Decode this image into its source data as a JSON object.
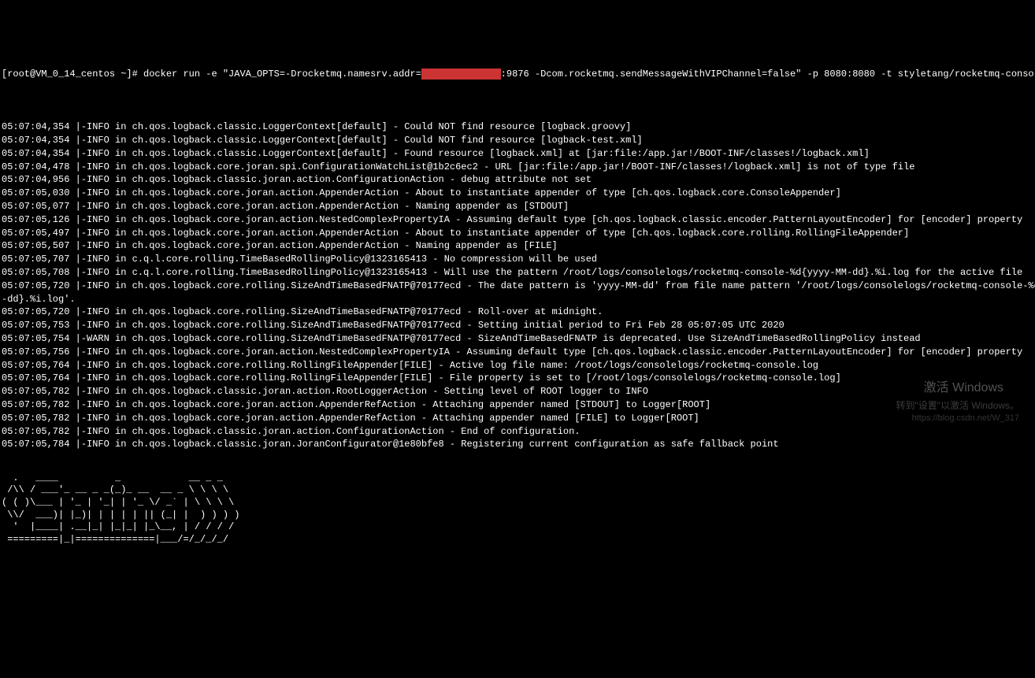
{
  "prompt": {
    "user_host": "[root@VM_0_14_centos ~]# ",
    "command_pre": "docker run -e \"JAVA_OPTS=-Drocketmq.namesrv.addr=",
    "redacted": "xx.xxx.xxx.xxx",
    "command_post": ":9876 -Dcom.rocketmq.sendMessageWithVIPChannel=false\" -p 8080:8080 -t styletang/rocketmq-console-ng"
  },
  "logs": [
    "05:07:04,354 |-INFO in ch.qos.logback.classic.LoggerContext[default] - Could NOT find resource [logback.groovy]",
    "05:07:04,354 |-INFO in ch.qos.logback.classic.LoggerContext[default] - Could NOT find resource [logback-test.xml]",
    "05:07:04,354 |-INFO in ch.qos.logback.classic.LoggerContext[default] - Found resource [logback.xml] at [jar:file:/app.jar!/BOOT-INF/classes!/logback.xml]",
    "05:07:04,478 |-INFO in ch.qos.logback.core.joran.spi.ConfigurationWatchList@1b2c6ec2 - URL [jar:file:/app.jar!/BOOT-INF/classes!/logback.xml] is not of type file",
    "05:07:04,956 |-INFO in ch.qos.logback.classic.joran.action.ConfigurationAction - debug attribute not set",
    "05:07:05,030 |-INFO in ch.qos.logback.core.joran.action.AppenderAction - About to instantiate appender of type [ch.qos.logback.core.ConsoleAppender]",
    "05:07:05,077 |-INFO in ch.qos.logback.core.joran.action.AppenderAction - Naming appender as [STDOUT]",
    "05:07:05,126 |-INFO in ch.qos.logback.core.joran.action.NestedComplexPropertyIA - Assuming default type [ch.qos.logback.classic.encoder.PatternLayoutEncoder] for [encoder] property",
    "05:07:05,497 |-INFO in ch.qos.logback.core.joran.action.AppenderAction - About to instantiate appender of type [ch.qos.logback.core.rolling.RollingFileAppender]",
    "05:07:05,507 |-INFO in ch.qos.logback.core.joran.action.AppenderAction - Naming appender as [FILE]",
    "05:07:05,707 |-INFO in c.q.l.core.rolling.TimeBasedRollingPolicy@1323165413 - No compression will be used",
    "05:07:05,708 |-INFO in c.q.l.core.rolling.TimeBasedRollingPolicy@1323165413 - Will use the pattern /root/logs/consolelogs/rocketmq-console-%d{yyyy-MM-dd}.%i.log for the active file",
    "05:07:05,720 |-INFO in ch.qos.logback.core.rolling.SizeAndTimeBasedFNATP@70177ecd - The date pattern is 'yyyy-MM-dd' from file name pattern '/root/logs/consolelogs/rocketmq-console-%d{yyyy",
    "-dd}.%i.log'.",
    "05:07:05,720 |-INFO in ch.qos.logback.core.rolling.SizeAndTimeBasedFNATP@70177ecd - Roll-over at midnight.",
    "05:07:05,753 |-INFO in ch.qos.logback.core.rolling.SizeAndTimeBasedFNATP@70177ecd - Setting initial period to Fri Feb 28 05:07:05 UTC 2020",
    "05:07:05,754 |-WARN in ch.qos.logback.core.rolling.SizeAndTimeBasedFNATP@70177ecd - SizeAndTimeBasedFNATP is deprecated. Use SizeAndTimeBasedRollingPolicy instead",
    "05:07:05,756 |-INFO in ch.qos.logback.core.joran.action.NestedComplexPropertyIA - Assuming default type [ch.qos.logback.classic.encoder.PatternLayoutEncoder] for [encoder] property",
    "05:07:05,764 |-INFO in ch.qos.logback.core.rolling.RollingFileAppender[FILE] - Active log file name: /root/logs/consolelogs/rocketmq-console.log",
    "05:07:05,764 |-INFO in ch.qos.logback.core.rolling.RollingFileAppender[FILE] - File property is set to [/root/logs/consolelogs/rocketmq-console.log]",
    "05:07:05,782 |-INFO in ch.qos.logback.classic.joran.action.RootLoggerAction - Setting level of ROOT logger to INFO",
    "05:07:05,782 |-INFO in ch.qos.logback.core.joran.action.AppenderRefAction - Attaching appender named [STDOUT] to Logger[ROOT]",
    "05:07:05,782 |-INFO in ch.qos.logback.core.joran.action.AppenderRefAction - Attaching appender named [FILE] to Logger[ROOT]",
    "05:07:05,782 |-INFO in ch.qos.logback.classic.joran.action.ConfigurationAction - End of configuration.",
    "05:07:05,784 |-INFO in ch.qos.logback.classic.joran.JoranConfigurator@1e80bfe8 - Registering current configuration as safe fallback point"
  ],
  "ascii": [
    "  .   ____          _            __ _ _",
    " /\\\\ / ___'_ __ _ _(_)_ __  __ _ \\ \\ \\ \\",
    "( ( )\\___ | '_ | '_| | '_ \\/ _` | \\ \\ \\ \\",
    " \\\\/  ___)| |_)| | | | | || (_| |  ) ) ) )",
    "  '  |____| .__|_| |_|_| |_\\__, | / / / /",
    " =========|_|==============|___/=/_/_/_/"
  ],
  "watermark": {
    "cn": "激活 Windows",
    "sub": "转到\"设置\"以激活 Windows。",
    "url": "https://blog.csdn.net/W_317"
  }
}
